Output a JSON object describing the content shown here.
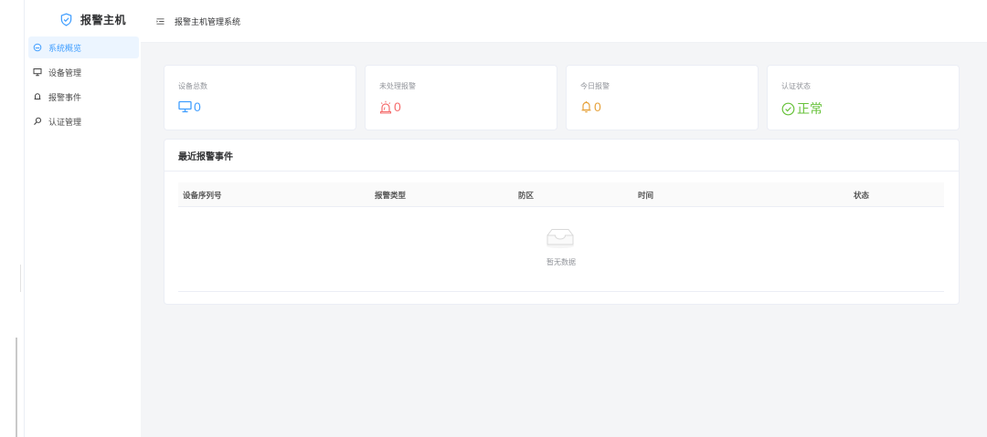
{
  "app": {
    "title": "报警主机"
  },
  "sidebar": {
    "items": [
      {
        "label": "系统概览",
        "icon": "dashboard-icon",
        "active": true
      },
      {
        "label": "设备管理",
        "icon": "monitor-icon",
        "active": false
      },
      {
        "label": "报警事件",
        "icon": "bell-icon",
        "active": false
      },
      {
        "label": "认证管理",
        "icon": "key-icon",
        "active": false
      }
    ]
  },
  "header": {
    "breadcrumb": "报警主机管理系统",
    "fold_icon": "menu-fold-icon"
  },
  "stats": [
    {
      "title": "设备总数",
      "value": "0",
      "icon": "monitor-icon",
      "color": "#409eff"
    },
    {
      "title": "未处理报警",
      "value": "0",
      "icon": "alarm-siren-icon",
      "color": "#f56c6c"
    },
    {
      "title": "今日报警",
      "value": "0",
      "icon": "bell-icon",
      "color": "#e6a23c"
    },
    {
      "title": "认证状态",
      "value": "正常",
      "icon": "check-circle-icon",
      "color": "#67c23a"
    }
  ],
  "recent_events": {
    "title": "最近报警事件",
    "columns": [
      "设备序列号",
      "报警类型",
      "防区",
      "时间",
      "状态"
    ],
    "rows": [],
    "empty_text": "暂无数据"
  },
  "colors": {
    "accent": "#409eff",
    "danger": "#f56c6c",
    "warning": "#e6a23c",
    "success": "#67c23a"
  }
}
